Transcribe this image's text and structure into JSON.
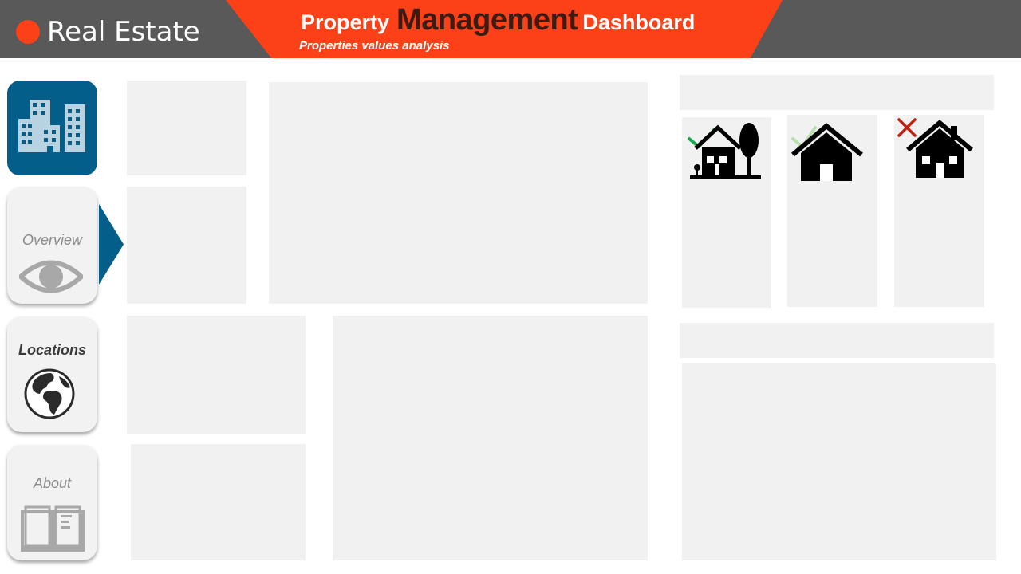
{
  "header": {
    "brand": "Real Estate",
    "title_part1": "Property",
    "title_part2": "Management",
    "title_part3": "Dashboard",
    "subtitle": "Properties values analysis"
  },
  "nav": {
    "logo_icon": "buildings-icon",
    "items": [
      {
        "label": "Overview",
        "icon": "eye-icon",
        "state": "selected"
      },
      {
        "label": "Locations",
        "icon": "globe-icon",
        "state": "bold"
      },
      {
        "label": "About",
        "icon": "book-icon",
        "state": "normal"
      }
    ]
  },
  "filters": [
    {
      "icon": "house-with-tree-icon",
      "status": "checked",
      "mark_color": "#1aaa55"
    },
    {
      "icon": "house-icon",
      "status": "checked-faded",
      "mark_color": "#b9dfb0"
    },
    {
      "icon": "house-with-chimney-icon",
      "status": "excluded",
      "mark_color": "#c0210f"
    }
  ],
  "colors": {
    "accent": "#fc4119",
    "header_bg": "#595959",
    "nav_blue": "#035e89",
    "panel": "#f1f1f1"
  }
}
